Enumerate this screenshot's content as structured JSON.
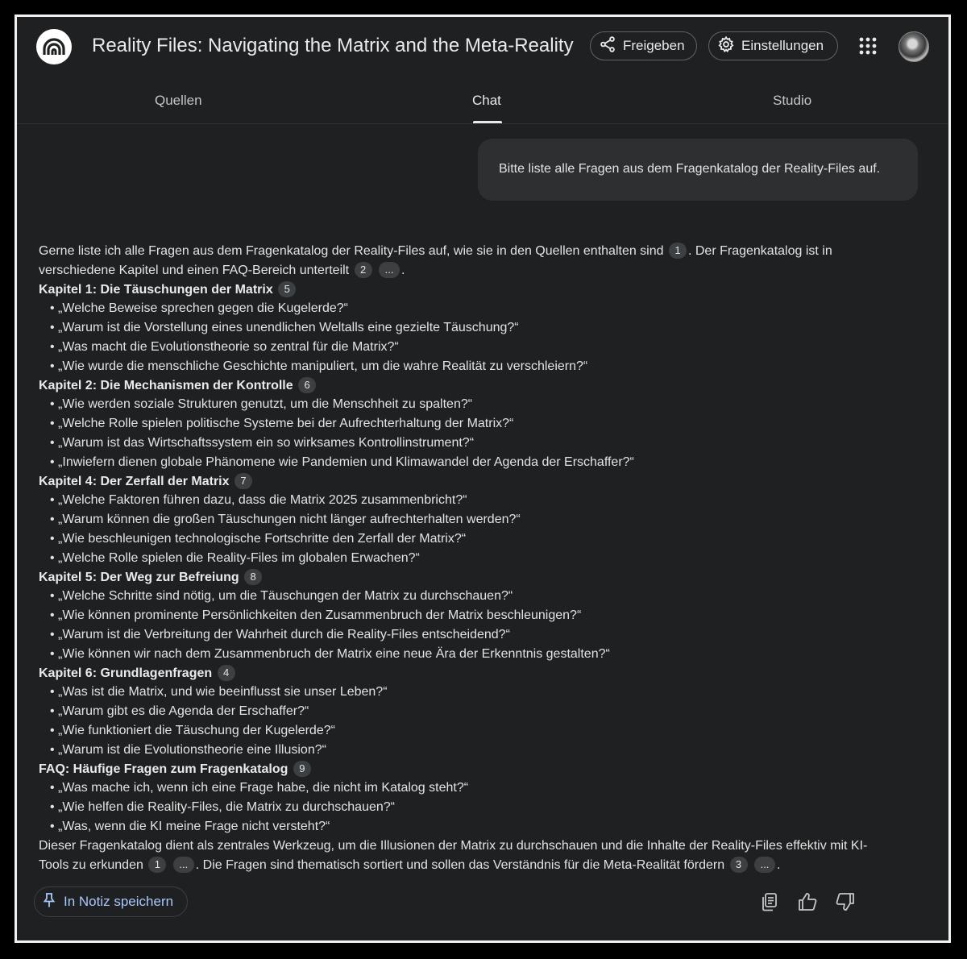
{
  "header": {
    "title": "Reality Files: Navigating the Matrix and the Meta-Reality",
    "share_label": "Freigeben",
    "settings_label": "Einstellungen"
  },
  "tabs": [
    {
      "label": "Quellen"
    },
    {
      "label": "Chat",
      "active": true
    },
    {
      "label": "Studio"
    }
  ],
  "user_message": "Bitte liste alle Fragen aus dem Fragenkatalog der Reality-Files auf.",
  "response": {
    "intro_1": "Gerne liste ich alle Fragen aus dem Fragenkatalog der Reality-Files auf, wie sie in den Quellen enthalten sind",
    "intro_cite_1": "1",
    "intro_2": ". Der Fragenkatalog ist in verschiedene Kapitel und einen FAQ-Bereich unterteilt",
    "intro_cite_2": "2",
    "intro_more": "...",
    "intro_end": ".",
    "sections": [
      {
        "title": "Kapitel 1: Die Täuschungen der Matrix",
        "cite": "5",
        "items": [
          "• „Welche Beweise sprechen gegen die Kugelerde?“",
          "• „Warum ist die Vorstellung eines unendlichen Weltalls eine gezielte Täuschung?“",
          "• „Was macht die Evolutionstheorie so zentral für die Matrix?“",
          "• „Wie wurde die menschliche Geschichte manipuliert, um die wahre Realität zu verschleiern?“"
        ]
      },
      {
        "title": "Kapitel 2: Die Mechanismen der Kontrolle",
        "cite": "6",
        "items": [
          "• „Wie werden soziale Strukturen genutzt, um die Menschheit zu spalten?“",
          "• „Welche Rolle spielen politische Systeme bei der Aufrechterhaltung der Matrix?“",
          "• „Warum ist das Wirtschaftssystem ein so wirksames Kontrollinstrument?“",
          "• „Inwiefern dienen globale Phänomene wie Pandemien und Klimawandel der Agenda der Erschaffer?“"
        ]
      },
      {
        "title": "Kapitel 4: Der Zerfall der Matrix",
        "cite": "7",
        "items": [
          "• „Welche Faktoren führen dazu, dass die Matrix 2025 zusammenbricht?“",
          "• „Warum können die großen Täuschungen nicht länger aufrechterhalten werden?“",
          "• „Wie beschleunigen technologische Fortschritte den Zerfall der Matrix?“",
          "• „Welche Rolle spielen die Reality-Files im globalen Erwachen?“"
        ]
      },
      {
        "title": "Kapitel 5: Der Weg zur Befreiung",
        "cite": "8",
        "items": [
          "• „Welche Schritte sind nötig, um die Täuschungen der Matrix zu durchschauen?“",
          "• „Wie können prominente Persönlichkeiten den Zusammenbruch der Matrix beschleunigen?“",
          "• „Warum ist die Verbreitung der Wahrheit durch die Reality-Files entscheidend?“",
          "• „Wie können wir nach dem Zusammenbruch der Matrix eine neue Ära der Erkenntnis gestalten?“"
        ]
      },
      {
        "title": "Kapitel 6: Grundlagenfragen",
        "cite": "4",
        "items": [
          "• „Was ist die Matrix, und wie beeinflusst sie unser Leben?“",
          "• „Warum gibt es die Agenda der Erschaffer?“",
          "• „Wie funktioniert die Täuschung der Kugelerde?“",
          "• „Warum ist die Evolutionstheorie eine Illusion?“"
        ]
      },
      {
        "title": "FAQ: Häufige Fragen zum Fragenkatalog",
        "cite": "9",
        "items": [
          "• „Was mache ich, wenn ich eine Frage habe, die nicht im Katalog steht?“",
          "• „Wie helfen die Reality-Files, die Matrix zu durchschauen?“",
          "• „Was, wenn die KI meine Frage nicht versteht?“"
        ]
      }
    ],
    "outro_1": "Dieser Fragenkatalog dient als zentrales Werkzeug, um die Illusionen der Matrix zu durchschauen und die Inhalte der Reality-Files effektiv mit KI-Tools zu erkunden",
    "outro_cite_1": "1",
    "outro_more_1": "...",
    "outro_2": ". Die Fragen sind thematisch sortiert und sollen das Verständnis für die Meta-Realität fördern",
    "outro_cite_2": "3",
    "outro_more_2": "...",
    "outro_end": "."
  },
  "footer": {
    "save_note_label": "In Notiz speichern"
  },
  "icons": {
    "logo": "notebook-logo-icon",
    "share": "share-icon",
    "settings": "gear-icon",
    "apps": "apps-grid-icon",
    "pin": "pin-icon",
    "copy": "copy-icon",
    "like": "thumbs-up-icon",
    "dislike": "thumbs-down-icon"
  },
  "colors": {
    "background": "#1f2021",
    "user_bubble": "#2d2f31",
    "accent": "#a8c7fa"
  }
}
